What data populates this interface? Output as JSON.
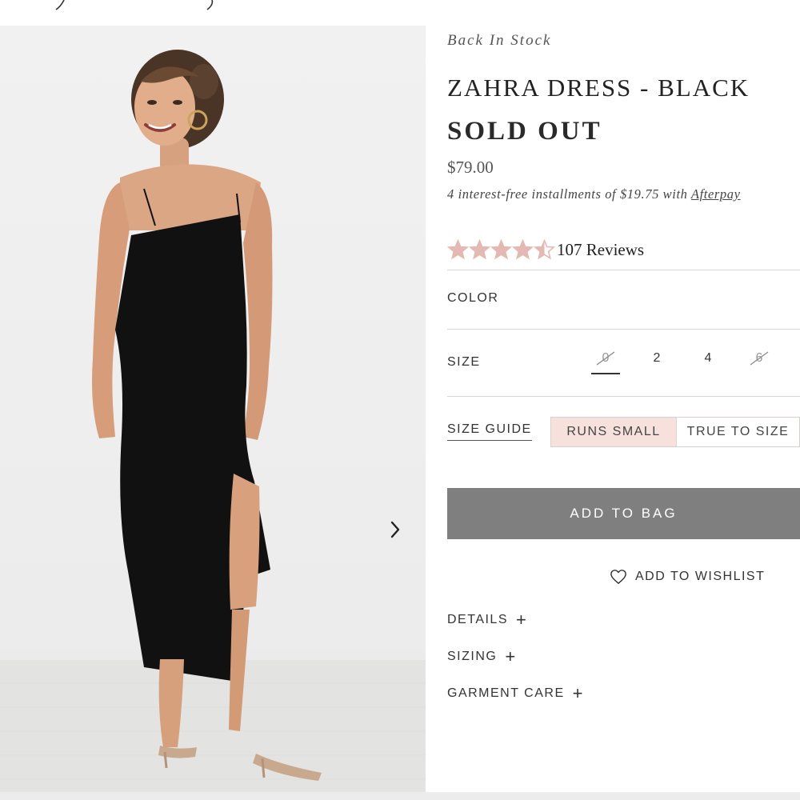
{
  "product": {
    "stock_status": "Back In Stock",
    "title": "ZAHRA DRESS - BLACK",
    "availability": "SOLD OUT",
    "price": "$79.00",
    "installments": {
      "text_before": "4 interest-free installments of $19.75 with ",
      "provider_link": "Afterpay"
    },
    "rating": {
      "value": 4.5,
      "max": 5,
      "star_color": "#e4b9b3",
      "reviews_label": "107 Reviews"
    }
  },
  "options": {
    "color_label": "COLOR",
    "size_label": "SIZE",
    "sizes": [
      {
        "label": "0",
        "available": false,
        "selected": true
      },
      {
        "label": "2",
        "available": true,
        "selected": false
      },
      {
        "label": "4",
        "available": true,
        "selected": false
      },
      {
        "label": "6",
        "available": false,
        "selected": false
      }
    ]
  },
  "fit": {
    "size_guide_label": "SIZE GUIDE",
    "runs_small_label": "RUNS SMALL",
    "true_to_size_label": "TRUE TO SIZE",
    "active": "RUNS SMALL",
    "active_color": "#f6e1dc"
  },
  "actions": {
    "add_to_bag_label": "ADD TO BAG",
    "add_to_bag_color": "#7f7f7f",
    "wishlist_label": "ADD TO WISHLIST"
  },
  "accordions": [
    {
      "label": "DETAILS"
    },
    {
      "label": "SIZING"
    },
    {
      "label": "GARMENT CARE"
    }
  ],
  "gallery": {
    "image_alt": "Model wearing black asymmetric midi dress",
    "next_icon": "chevron-right-icon"
  }
}
